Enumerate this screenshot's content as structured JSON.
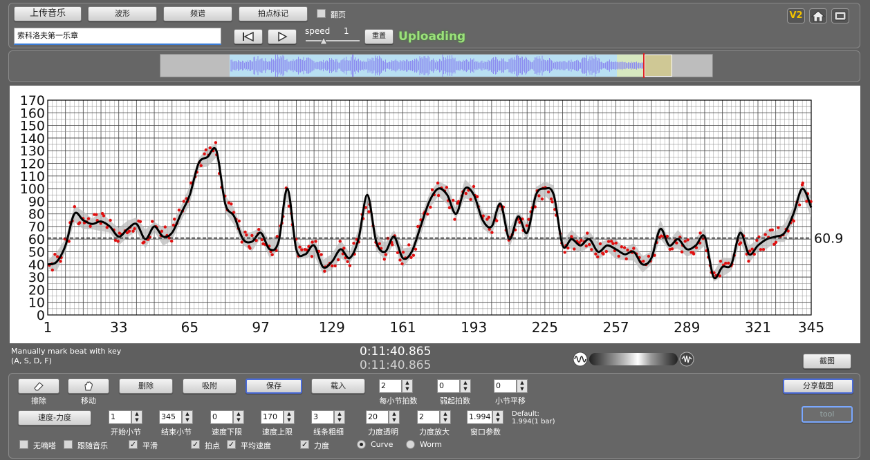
{
  "toolbar": {
    "upload_label": "上传音乐",
    "waveform_label": "波形",
    "spectrum_label": "频谱",
    "beat_mark_label": "拍点标记",
    "flip_label": "翻页",
    "song_title": "索科洛夫第一乐章",
    "speed_label": "speed",
    "speed_value": "1",
    "reset_label": "重置",
    "status_text": "Uploading",
    "version_badge": "V2"
  },
  "info": {
    "hint_line1": "Manually mark beat with key",
    "hint_line2": "(A, S, D, F)",
    "time_current": "0:11:40.865",
    "time_total": "0:11:40.865",
    "screenshot_label": "截图"
  },
  "controls": {
    "erase_label": "擦除",
    "move_label": "移动",
    "delete_label": "删除",
    "snap_label": "吸附",
    "save_label": "保存",
    "load_label": "载入",
    "beats_per_bar_value": "2",
    "beats_per_bar_label": "每小节拍数",
    "pickup_value": "0",
    "pickup_label": "弱起拍数",
    "bar_shift_value": "0",
    "bar_shift_label": "小节平移",
    "share_label": "分享截图",
    "tool_label": "tool",
    "mode_label": "速度-力度",
    "start_bar_value": "1",
    "start_bar_label": "开始小节",
    "end_bar_value": "345",
    "end_bar_label": "结束小节",
    "tempo_min_value": "0",
    "tempo_min_label": "速度下限",
    "tempo_max_value": "170",
    "tempo_max_label": "速度上限",
    "line_width_value": "3",
    "line_width_label": "线条粗细",
    "dyn_opacity_value": "20",
    "dyn_opacity_label": "力度透明",
    "dyn_scale_value": "2",
    "dyn_scale_label": "力度放大",
    "window_value": "1.994",
    "window_label": "窗口参数",
    "default_line1": "Default:",
    "default_line2": "1.994(1 bar)",
    "no_click_label": "无嘀嗒",
    "follow_music_label": "跟随音乐",
    "smooth_label": "平滑",
    "beat_points_label": "拍点",
    "avg_tempo_label": "平均速度",
    "dynamics_label": "力度",
    "curve_label": "Curve",
    "worm_label": "Worm"
  },
  "states": {
    "flip_checked": false,
    "no_click_checked": false,
    "follow_music_checked": false,
    "smooth_checked": true,
    "beat_points_checked": true,
    "avg_tempo_checked": true,
    "dynamics_checked": true,
    "mode_selected": "Curve"
  },
  "colors": {
    "status_green": "#9be27a",
    "curve": "#000000",
    "points": "#e01010",
    "band": "#b8b8b8",
    "waveform": "#8c8cf0",
    "badge": "#f2c200"
  },
  "chart_data": {
    "type": "line",
    "ylim": [
      0,
      170
    ],
    "xlim": [
      1,
      345
    ],
    "yticks": [
      0,
      10,
      20,
      30,
      40,
      50,
      60,
      70,
      80,
      90,
      100,
      110,
      120,
      130,
      140,
      150,
      160,
      170
    ],
    "xticks": [
      1,
      33,
      65,
      97,
      129,
      161,
      193,
      225,
      257,
      289,
      321,
      345
    ],
    "average_value": 60.9,
    "average_label": "60.9",
    "series": [
      {
        "x": [
          1,
          5,
          9,
          13,
          17,
          21,
          25,
          29,
          33,
          37,
          41,
          45,
          49,
          53,
          57,
          61,
          65,
          69,
          73,
          77,
          81,
          85,
          89,
          93,
          97,
          101,
          105,
          109,
          113,
          117,
          121,
          125,
          129,
          133,
          137,
          141,
          145,
          149,
          153,
          157,
          161,
          165,
          169,
          173,
          177,
          181,
          185,
          189,
          193,
          197,
          201,
          205,
          209,
          213,
          217,
          221,
          225,
          229,
          233,
          237,
          241,
          245,
          249,
          253,
          257,
          261,
          265,
          269,
          273,
          277,
          281,
          285,
          289,
          293,
          297,
          301,
          305,
          309,
          313,
          317,
          321,
          325,
          329,
          333,
          337,
          341,
          345
        ],
        "values": [
          40,
          42,
          55,
          80,
          75,
          72,
          74,
          70,
          62,
          68,
          72,
          60,
          70,
          62,
          65,
          80,
          95,
          120,
          125,
          130,
          88,
          78,
          60,
          58,
          65,
          52,
          58,
          100,
          52,
          48,
          55,
          38,
          42,
          52,
          45,
          60,
          95,
          58,
          50,
          62,
          45,
          50,
          70,
          90,
          100,
          95,
          80,
          100,
          95,
          75,
          70,
          88,
          60,
          78,
          65,
          95,
          100,
          95,
          55,
          60,
          55,
          60,
          50,
          55,
          52,
          48,
          50,
          40,
          45,
          68,
          55,
          60,
          52,
          55,
          62,
          30,
          38,
          40,
          65,
          48,
          55,
          60,
          62,
          65,
          80,
          100,
          85
        ]
      }
    ]
  }
}
